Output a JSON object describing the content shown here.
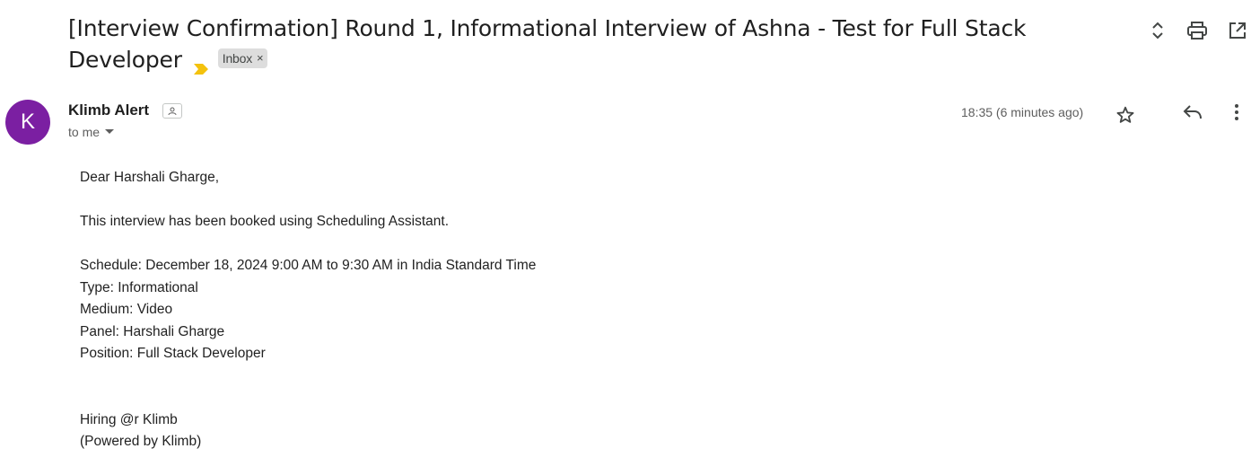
{
  "subject": {
    "text": "[Interview Confirmation] Round 1, Informational Interview of Ashna - Test for Full Stack Developer",
    "label": "Inbox",
    "label_close": "×"
  },
  "toolbar": {
    "icons": [
      "expand-collapse-icon",
      "print-icon",
      "open-in-new-window-icon"
    ]
  },
  "sender": {
    "avatar_letter": "K",
    "avatar_color": "#7b1fa2",
    "name": "Klimb Alert",
    "recipient": "to me",
    "timestamp": "18:35 (6 minutes ago)"
  },
  "body": {
    "greeting": "Dear Harshali Gharge,",
    "intro": "This interview has been booked using Scheduling Assistant.",
    "schedule": "Schedule: December 18, 2024 9:00 AM to 9:30 AM in India Standard Time",
    "type": "Type: Informational",
    "medium": "Medium: Video",
    "panel": "Panel: Harshali Gharge",
    "position": "Position: Full Stack Developer",
    "signature": "Hiring @r Klimb",
    "powered_by": "(Powered by Klimb)"
  },
  "colors": {
    "importance_marker": "#f4c20d",
    "text": "#1f1f1f",
    "secondary_text": "#5e5e5e"
  }
}
